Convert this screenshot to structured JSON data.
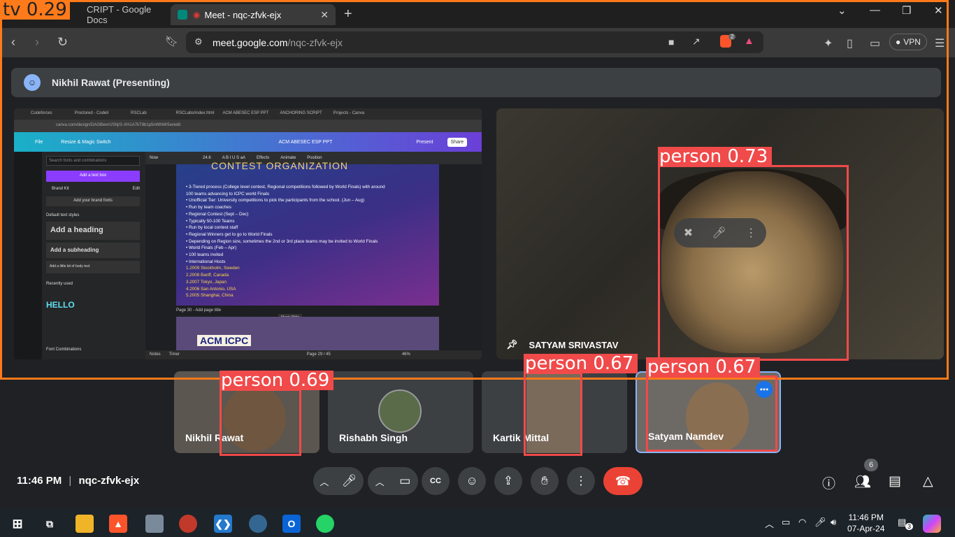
{
  "browser": {
    "tabs": [
      {
        "label": "CRIPT - Google Docs",
        "active": false
      },
      {
        "label": "Meet - nqc-zfvk-ejx",
        "active": true
      }
    ],
    "new_tab": "+",
    "url_host": "meet.google.com",
    "url_path": "/nqc-zfvk-ejx",
    "vpn_label": "VPN",
    "brave_badge": "2"
  },
  "meet": {
    "presenting_label": "Nikhil Rawat (Presenting)",
    "spotlight_name": "SATYAM SRIVASTAV",
    "participants": [
      {
        "name": "Nikhil Rawat"
      },
      {
        "name": "Rishabh Singh"
      },
      {
        "name": "Kartik Mittal"
      },
      {
        "name": "Satyam Namdev"
      }
    ],
    "time": "11:46 PM",
    "separator": "|",
    "meeting_code": "nqc-zfvk-ejx",
    "people_count": "6"
  },
  "shared_screen": {
    "tabs": [
      "Codeforces",
      "Proctored - Codeli",
      "RSCLab",
      "RSCLabs/index.html",
      "ACM ABESEC ESP PPT",
      "ANCHORING SCRIPT",
      "Projects - Canva"
    ],
    "url": "canva.com/design/DAGBwvrUShj/S-XH1A7kT8b1p5nWhWr5w/edit",
    "canva_file": "File",
    "canva_resize": "Resize & Magic Switch",
    "canva_title": "ACM ABESEC ESP PPT",
    "canva_present": "Present",
    "canva_share": "Share",
    "search_placeholder": "Search fonts and combinations",
    "add_text_box": "Add a text box",
    "brand_kit": "Brand Kit",
    "edit": "Edit",
    "add_brand_fonts": "Add your brand fonts",
    "default_styles": "Default text styles",
    "add_heading": "Add a heading",
    "add_subheading": "Add a subheading",
    "add_body": "Add a little bit of body text",
    "recently_used": "Recently used",
    "font_combinations": "Font Combinations",
    "toolbar_font": "Now",
    "toolbar_size": "24.6",
    "toolbar_effects": "Effects",
    "toolbar_animate": "Animate",
    "toolbar_position": "Position",
    "slide_title": "CONTEST ORGANIZATION",
    "slide_lines": [
      "• 3-Tiered process (College level contest, Regional competitions followed by World Finals) with around",
      "  100 teams advancing to ICPC world Finals",
      "• Unofficial Tier: University competitions to pick the participants from the school. (Jun – Aug)",
      "• Run by team coaches",
      "• Regional Contest (Sept – Dec)",
      "• Typically 50-100 Teams",
      "• Run by local contest staff",
      "• Regional Winners get to go to World Finals",
      "• Depending on Region size, sometimes the 2nd or 3rd place teams may be invited to World Finals",
      "• World Finals (Feb – Apr)",
      "• 100 teams invited",
      "• International Hosts"
    ],
    "slide_hosts": [
      "1.2009 Stockholm, Sweden",
      "2.2008 Banff, Canada",
      "3.2007 Tokyo, Japan",
      "4.2006 San Antonio, USA",
      "5.2005 Shanghai, China"
    ],
    "page_label": "Page 30 - Add page title",
    "magic_write": "Magic Write",
    "notes": "Notes",
    "timer": "Timer",
    "page_count": "Page 29 / 45",
    "zoom": "46%",
    "next_slide_text": "ACM ICPC"
  },
  "detections": [
    {
      "label": "tv 0.29"
    },
    {
      "label": "person 0.73"
    },
    {
      "label": "person 0.69"
    },
    {
      "label": "person 0.67"
    },
    {
      "label": "person 0.67"
    }
  ],
  "taskbar": {
    "time": "11:46 PM",
    "date": "07-Apr-24",
    "notif_count": "3"
  },
  "colors": {
    "end_call": "#ea4335",
    "detection_person": "#f04a4a",
    "detection_tv": "#ff7a1a",
    "meet_bg": "#202124"
  }
}
